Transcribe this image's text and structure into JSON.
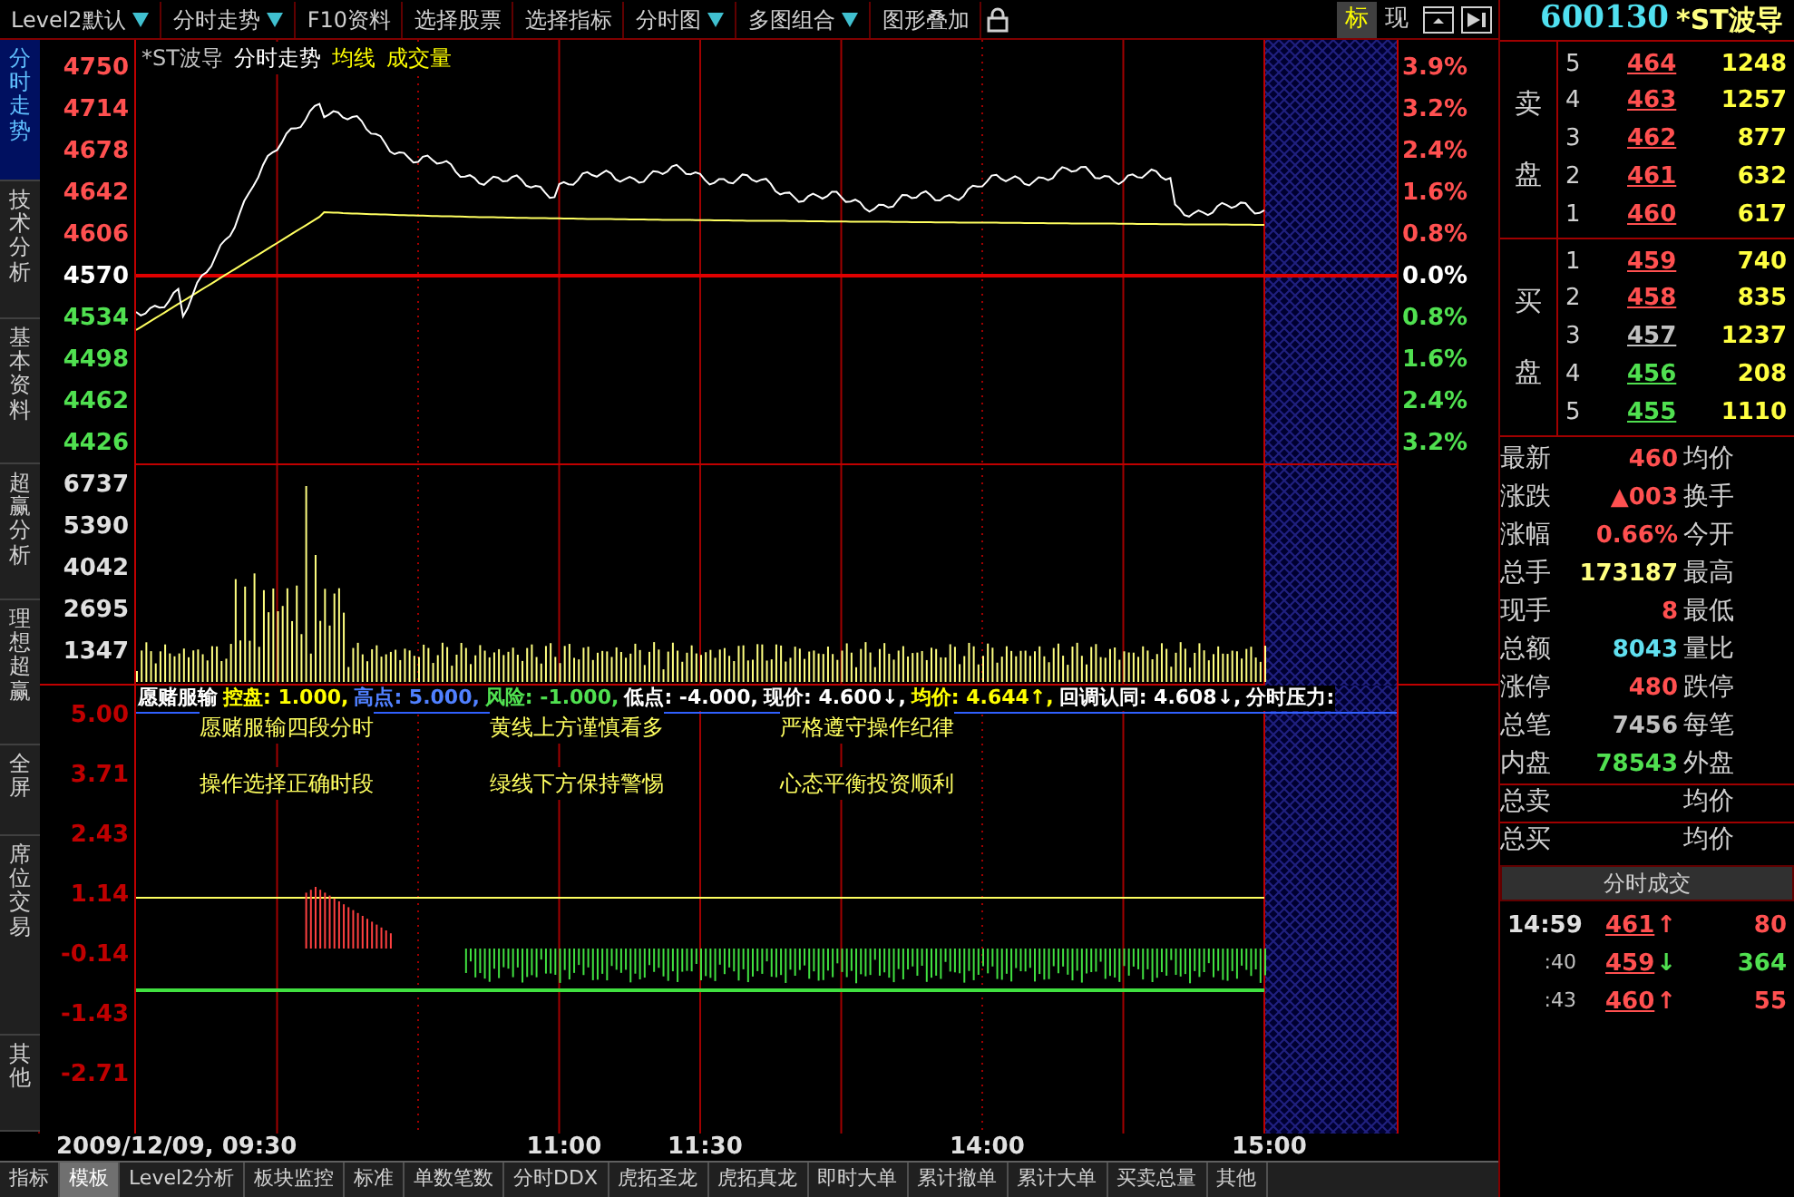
{
  "toolbar": {
    "items": [
      {
        "label": "Level2默认",
        "dropdown": true
      },
      {
        "label": "分时走势",
        "dropdown": true
      },
      {
        "label": "F10资料",
        "dropdown": false
      },
      {
        "label": "选择股票",
        "dropdown": false
      },
      {
        "label": "选择指标",
        "dropdown": false
      },
      {
        "label": "分时图",
        "dropdown": true
      },
      {
        "label": "多图组合",
        "dropdown": true
      },
      {
        "label": "图形叠加",
        "dropdown": false
      }
    ],
    "mode_tabs": [
      {
        "label": "标",
        "selected": true
      },
      {
        "label": "现",
        "selected": false
      }
    ]
  },
  "side_tabs": [
    {
      "label": "分时走势",
      "selected": true
    },
    {
      "label": "技术分析",
      "selected": false
    },
    {
      "label": "基本资料",
      "selected": false
    },
    {
      "label": "超赢分析",
      "selected": false
    },
    {
      "label": "理想超赢",
      "selected": false
    },
    {
      "label": "全屏",
      "selected": false
    },
    {
      "label": "席位交易",
      "selected": false
    },
    {
      "label": "其他",
      "selected": false
    }
  ],
  "chart": {
    "title": [
      {
        "text": "*ST波导",
        "color": "#c0c0c0"
      },
      {
        "text": "分时走势",
        "color": "#ffffff"
      },
      {
        "text": "均线",
        "color": "#ffff00"
      },
      {
        "text": "成交量",
        "color": "#ffff00"
      }
    ],
    "price_labels": [
      {
        "text": "4750",
        "color": "#ff5050"
      },
      {
        "text": "4714",
        "color": "#ff5050"
      },
      {
        "text": "4678",
        "color": "#ff5050"
      },
      {
        "text": "4642",
        "color": "#ff5050"
      },
      {
        "text": "4606",
        "color": "#ff5050"
      },
      {
        "text": "4570",
        "color": "#ffffff"
      },
      {
        "text": "4534",
        "color": "#50e050"
      },
      {
        "text": "4498",
        "color": "#50e050"
      },
      {
        "text": "4462",
        "color": "#50e050"
      },
      {
        "text": "4426",
        "color": "#50e050"
      }
    ],
    "percent_labels": [
      {
        "text": "3.9%",
        "color": "#ff5050"
      },
      {
        "text": "3.2%",
        "color": "#ff5050"
      },
      {
        "text": "2.4%",
        "color": "#ff5050"
      },
      {
        "text": "1.6%",
        "color": "#ff5050"
      },
      {
        "text": "0.8%",
        "color": "#ff5050"
      },
      {
        "text": "0.0%",
        "color": "#ffffff"
      },
      {
        "text": "0.8%",
        "color": "#50e050"
      },
      {
        "text": "1.6%",
        "color": "#50e050"
      },
      {
        "text": "2.4%",
        "color": "#50e050"
      },
      {
        "text": "3.2%",
        "color": "#50e050"
      }
    ],
    "volume_labels": [
      "6737",
      "5390",
      "4042",
      "2695",
      "1347"
    ],
    "indicator_header": [
      {
        "text": "愿赌服输",
        "kind": "name"
      },
      {
        "text": "控盘: 1.000,",
        "kind": "setting"
      },
      {
        "text": "高点: 5.000,",
        "kind": "upper"
      },
      {
        "text": "风险: -1.000,",
        "kind": "risk"
      },
      {
        "text": "低点: -4.000,",
        "kind": "reading"
      },
      {
        "text": "现价: 4.600↓,",
        "kind": "reading"
      },
      {
        "text": "均价: 4.644↑,",
        "kind": "setting"
      },
      {
        "text": "回调认同: 4.608↓,",
        "kind": "reading"
      },
      {
        "text": "分时压力:",
        "kind": "reading"
      }
    ],
    "indicator_labels": [
      "5.00",
      "3.71",
      "2.43",
      "1.14",
      "-0.14",
      "-1.43",
      "-2.71"
    ],
    "notes": [
      "愿赌服输四段分时",
      "黄线上方谨慎看多",
      "严格遵守操作纪律",
      "操作选择正确时段",
      "绿线下方保持警惕",
      "心态平衡投资顺利"
    ],
    "time_labels": [
      "2009/12/09, 09:30",
      "11:00",
      "11:30",
      "14:00",
      "15:00"
    ]
  },
  "quote": {
    "code": "600130",
    "name": "*ST波导",
    "sell_label": "卖盘",
    "buy_label": "买盘",
    "sell": [
      {
        "level": "5",
        "price": "464",
        "volume": "1248",
        "color": "#ff5050"
      },
      {
        "level": "4",
        "price": "463",
        "volume": "1257",
        "color": "#ff5050"
      },
      {
        "level": "3",
        "price": "462",
        "volume": "877",
        "color": "#ff5050"
      },
      {
        "level": "2",
        "price": "461",
        "volume": "632",
        "color": "#ff5050"
      },
      {
        "level": "1",
        "price": "460",
        "volume": "617",
        "color": "#ff5050"
      }
    ],
    "buy": [
      {
        "level": "1",
        "price": "459",
        "volume": "740",
        "color": "#ff5050"
      },
      {
        "level": "2",
        "price": "458",
        "volume": "835",
        "color": "#ff5050"
      },
      {
        "level": "3",
        "price": "457",
        "volume": "1237",
        "color": "#c0c0c0"
      },
      {
        "level": "4",
        "price": "456",
        "volume": "208",
        "color": "#50e050"
      },
      {
        "level": "5",
        "price": "455",
        "volume": "1110",
        "color": "#50e050"
      }
    ],
    "stats": [
      {
        "label": "最新",
        "value": "460",
        "color": "#ff5050",
        "label_2": "均价"
      },
      {
        "label": "涨跌",
        "value": "▲003",
        "color": "#ff5050",
        "label_2": "换手"
      },
      {
        "label": "涨幅",
        "value": "0.66%",
        "color": "#ff5050",
        "label_2": "今开"
      },
      {
        "label": "总手",
        "value": "173187",
        "color": "#ffff80",
        "label_2": "最高"
      },
      {
        "label": "现手",
        "value": "8",
        "color": "#ff5050",
        "label_2": "最低"
      },
      {
        "label": "总额",
        "value": "8043",
        "color": "#60e0f0",
        "label_2": "量比"
      },
      {
        "label": "涨停",
        "value": "480",
        "color": "#ff5050",
        "label_2": "跌停"
      },
      {
        "label": "总笔",
        "value": "7456",
        "color": "#c0c0c0",
        "label_2": "每笔"
      },
      {
        "label": "内盘",
        "value": "78543",
        "color": "#50e050",
        "label_2": "外盘"
      }
    ],
    "totals": [
      {
        "label": "总卖",
        "label_2": "均价"
      },
      {
        "label": "总买",
        "label_2": "均价"
      }
    ],
    "ticks_title": "分时成交",
    "ticks": [
      {
        "time": "14:59",
        "price": "461",
        "arrow": "↑",
        "volume": "80",
        "color": "#ff5050"
      },
      {
        "time": ":40",
        "price": "459",
        "arrow": "↓",
        "volume": "364",
        "color": "#50e050"
      },
      {
        "time": ":43",
        "price": "460",
        "arrow": "↑",
        "volume": "55",
        "color": "#ff5050"
      }
    ]
  },
  "bottom_tabs": [
    {
      "label": "指标",
      "selected": false
    },
    {
      "label": "模板",
      "selected": true
    },
    {
      "label": "Level2分析",
      "selected": false
    },
    {
      "label": "板块监控",
      "selected": false
    },
    {
      "label": "标准",
      "selected": false
    },
    {
      "label": "单数笔数",
      "selected": false
    },
    {
      "label": "分时DDX",
      "selected": false
    },
    {
      "label": "虎拓圣龙",
      "selected": false
    },
    {
      "label": "虎拓真龙",
      "selected": false
    },
    {
      "label": "即时大单",
      "selected": false
    },
    {
      "label": "累计撤单",
      "selected": false
    },
    {
      "label": "累计大单",
      "selected": false
    },
    {
      "label": "买卖总量",
      "selected": false
    },
    {
      "label": "其他",
      "selected": false
    }
  ]
}
